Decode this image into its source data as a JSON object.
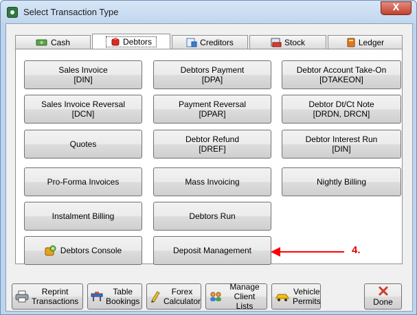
{
  "window": {
    "title": "Select Transaction Type",
    "close_glyph": "X"
  },
  "tabs": [
    {
      "label": "Cash",
      "icon": "cash-icon",
      "active": false
    },
    {
      "label": "Debtors",
      "icon": "debtors-icon",
      "active": true
    },
    {
      "label": "Creditors",
      "icon": "creditors-icon",
      "active": false
    },
    {
      "label": "Stock",
      "icon": "stock-icon",
      "active": false
    },
    {
      "label": "Ledger",
      "icon": "ledger-icon",
      "active": false
    }
  ],
  "buttons": [
    {
      "line1": "Sales Invoice",
      "line2": "[DIN]"
    },
    {
      "line1": "Debtors Payment",
      "line2": "[DPA]"
    },
    {
      "line1": "Debtor Account Take-On",
      "line2": "[DTAKEON]"
    },
    {
      "line1": "Sales Invoice Reversal",
      "line2": "[DCN]"
    },
    {
      "line1": "Payment Reversal",
      "line2": "[DPAR]"
    },
    {
      "line1": "Debtor Dt/Ct Note",
      "line2": "[DRDN, DRCN]"
    },
    {
      "line1": "Quotes",
      "line2": ""
    },
    {
      "line1": "Debtor Refund",
      "line2": "[DREF]"
    },
    {
      "line1": "Debtor Interest Run",
      "line2": "[DIN]"
    },
    {
      "line1": "Pro-Forma Invoices",
      "line2": ""
    },
    {
      "line1": "Mass Invoicing",
      "line2": ""
    },
    {
      "line1": "Nightly Billing",
      "line2": ""
    },
    {
      "line1": "Instalment Billing",
      "line2": ""
    },
    {
      "line1": "Debtors Run",
      "line2": ""
    },
    {
      "line1": "Debtors Console",
      "line2": ""
    },
    {
      "line1": "Deposit Management",
      "line2": ""
    }
  ],
  "annotation": {
    "label": "4.",
    "color": "#e00000"
  },
  "bottom_buttons": [
    {
      "line1": "Reprint",
      "line2": "Transactions",
      "icon": "printer-icon"
    },
    {
      "line1": "Table",
      "line2": "Bookings",
      "icon": "table-icon"
    },
    {
      "line1": "Forex",
      "line2": "Calculator",
      "icon": "forex-icon"
    },
    {
      "line1": "Manage",
      "line2": "Client Lists",
      "icon": "users-icon"
    },
    {
      "line1": "Vehicle",
      "line2": "Permits",
      "icon": "car-icon"
    },
    {
      "line1": "Done",
      "line2": "",
      "icon": "close-icon"
    }
  ],
  "colors": {
    "accent": "#e00000",
    "window_frame": "#bcd4ee",
    "done_icon": "#d23a2a"
  }
}
